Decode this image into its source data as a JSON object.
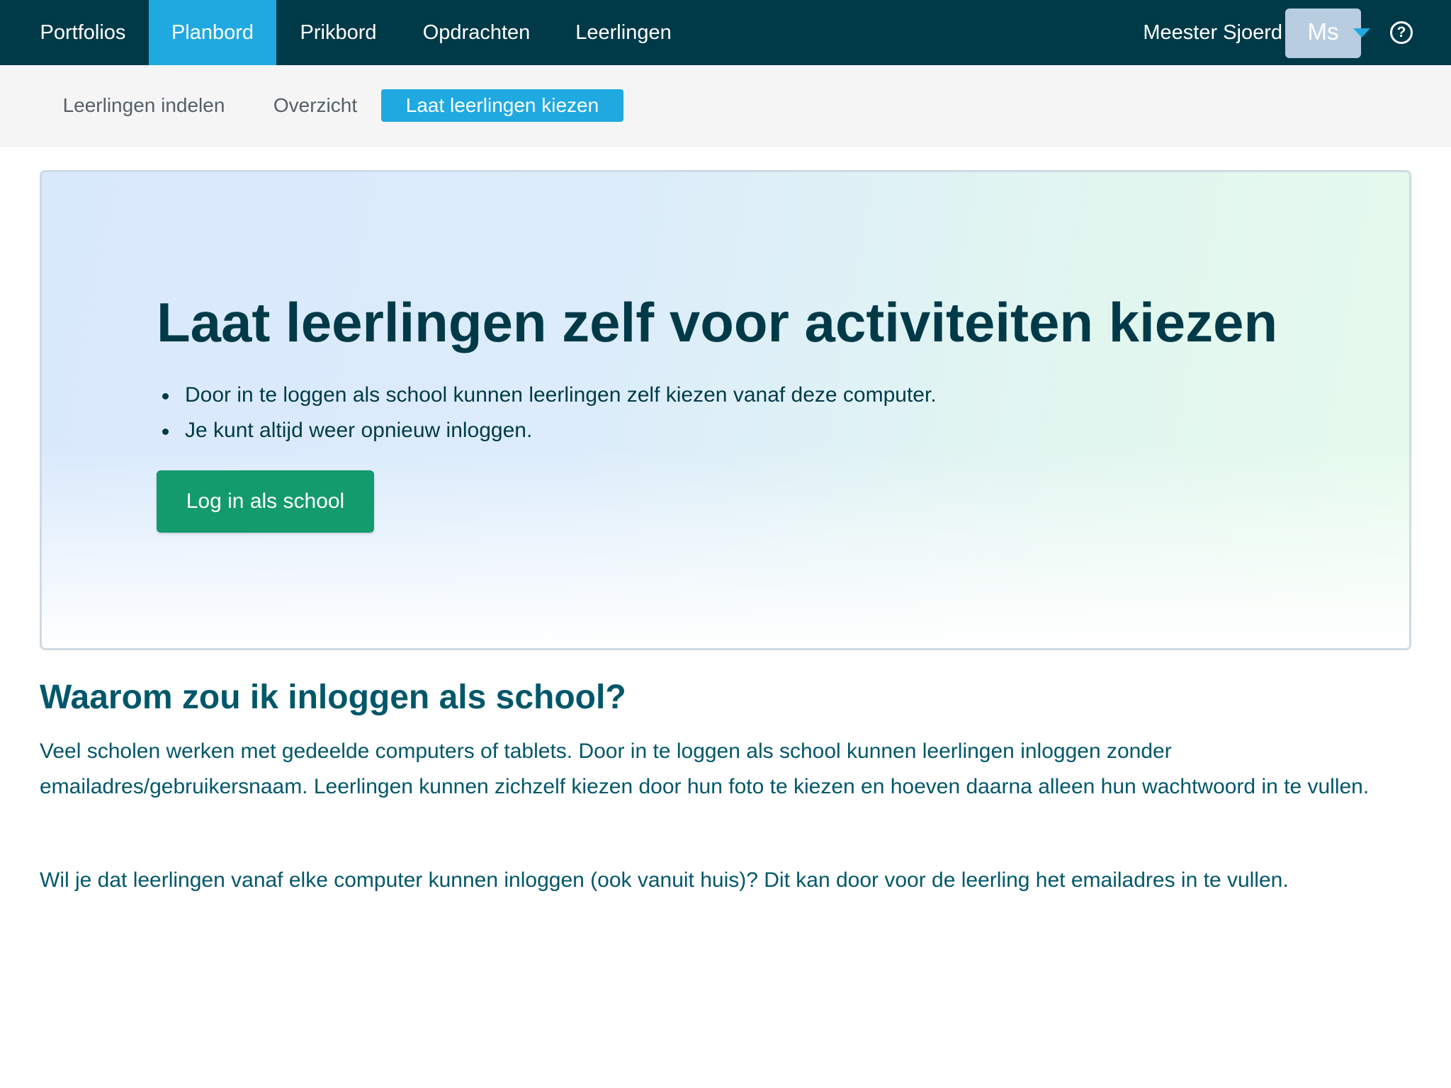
{
  "topnav": {
    "items": [
      {
        "label": "Portfolios",
        "active": false
      },
      {
        "label": "Planbord",
        "active": true
      },
      {
        "label": "Prikbord",
        "active": false
      },
      {
        "label": "Opdrachten",
        "active": false
      },
      {
        "label": "Leerlingen",
        "active": false
      }
    ],
    "user": {
      "name": "Meester Sjoerd",
      "initials": "Ms"
    },
    "help_glyph": "?"
  },
  "subnav": {
    "items": [
      {
        "label": "Leerlingen indelen",
        "active": false
      },
      {
        "label": "Overzicht",
        "active": false
      },
      {
        "label": "Laat leerlingen kiezen",
        "active": true
      }
    ]
  },
  "hero": {
    "title": "Laat leerlingen zelf voor activiteiten kiezen",
    "bullets": [
      "Door in te loggen als school kunnen leerlingen zelf kiezen vanaf deze computer.",
      "Je kunt altijd weer opnieuw inloggen."
    ],
    "button_label": "Log in als school"
  },
  "info": {
    "title": "Waarom zou ik inloggen als school?",
    "paragraphs": [
      "Veel scholen werken met gedeelde computers of tablets. Door in te loggen als school kunnen leerlingen inloggen zonder emailadres/gebruikersnaam. Leerlingen kunnen zichzelf kiezen door hun foto te kiezen en hoeven daarna alleen hun wachtwoord in te vullen.",
      "Wil je dat leerlingen vanaf elke computer kunnen inloggen (ook vanuit huis)? Dit kan door voor de leerling het emailadres in te vullen."
    ]
  },
  "colors": {
    "navbar": "#003a48",
    "accent": "#1fa9e0",
    "button": "#139a6d",
    "text": "#00576a"
  }
}
